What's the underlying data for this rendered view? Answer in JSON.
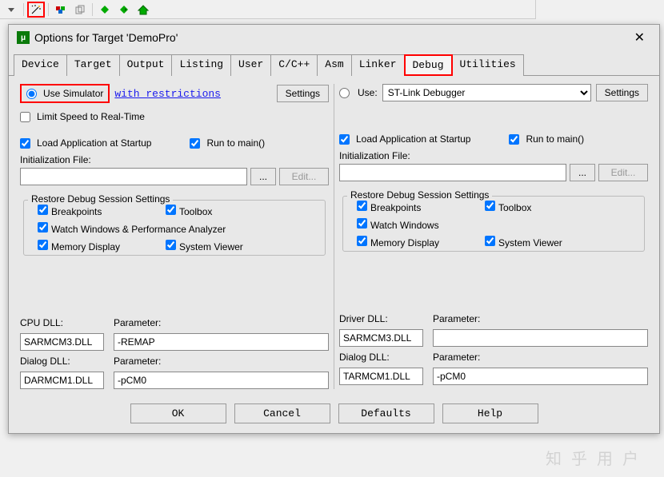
{
  "dialog": {
    "title": "Options for Target 'DemoPro'"
  },
  "tabs": {
    "device": "Device",
    "target": "Target",
    "output": "Output",
    "listing": "Listing",
    "user": "User",
    "ccpp": "C/C++",
    "asm": "Asm",
    "linker": "Linker",
    "debug": "Debug",
    "utilities": "Utilities"
  },
  "left": {
    "use_sim": "Use Simulator",
    "restrictions": "with restrictions",
    "settings": "Settings",
    "limit_speed": "Limit Speed to Real-Time",
    "load_app": "Load Application at Startup",
    "run_to_main": "Run to main()",
    "init_file": "Initialization File:",
    "browse": "...",
    "edit": "Edit...",
    "restore_title": "Restore Debug Session Settings",
    "bp": "Breakpoints",
    "toolbox": "Toolbox",
    "watch": "Watch Windows & Performance Analyzer",
    "mem": "Memory Display",
    "sys": "System Viewer",
    "cpu_dll": "CPU DLL:",
    "param": "Parameter:",
    "cpu_dll_v": "SARMCM3.DLL",
    "param1_v": "-REMAP",
    "dialog_dll": "Dialog DLL:",
    "dialog_dll_v": "DARMCM1.DLL",
    "param2_v": "-pCM0"
  },
  "right": {
    "use": "Use:",
    "debugger": "ST-Link Debugger",
    "settings": "Settings",
    "load_app": "Load Application at Startup",
    "run_to_main": "Run to main()",
    "init_file": "Initialization File:",
    "browse": "...",
    "edit": "Edit...",
    "restore_title": "Restore Debug Session Settings",
    "bp": "Breakpoints",
    "toolbox": "Toolbox",
    "watch": "Watch Windows",
    "mem": "Memory Display",
    "sys": "System Viewer",
    "driver_dll": "Driver DLL:",
    "param": "Parameter:",
    "driver_dll_v": "SARMCM3.DLL",
    "param1_v": "",
    "dialog_dll": "Dialog DLL:",
    "dialog_dll_v": "TARMCM1.DLL",
    "param2_v": "-pCM0"
  },
  "buttons": {
    "ok": "OK",
    "cancel": "Cancel",
    "defaults": "Defaults",
    "help": "Help"
  },
  "watermark": "知乎用户"
}
